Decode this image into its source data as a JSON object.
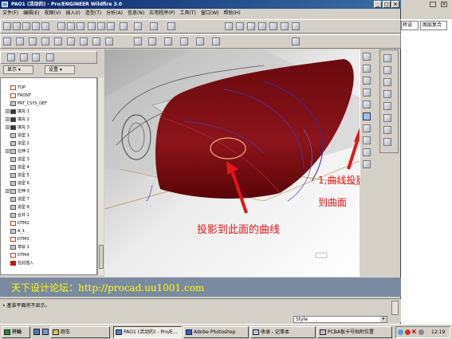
{
  "window": {
    "title": "PAO1 (活动的) - Pro/ENGINEER Wildfire 3.0"
  },
  "menu": [
    "文件(F)",
    "编辑(E)",
    "视图(V)",
    "插入(I)",
    "造型(T)",
    "分析(A)",
    "信息(N)",
    "应用程序(P)",
    "工具(T)",
    "窗口(W)",
    "帮助(H)"
  ],
  "nav_tabs": {
    "show": "显示",
    "settings": "设置"
  },
  "tree": [
    {
      "label": "TOP",
      "icon": "datum-plane-icon",
      "exp": ""
    },
    {
      "label": "FRONT",
      "icon": "datum-plane-icon",
      "exp": ""
    },
    {
      "label": "PRT_CSYS_DEF",
      "icon": "csys-icon",
      "exp": ""
    },
    {
      "label": "填充 1",
      "icon": "fill-icon",
      "exp": "+"
    },
    {
      "label": "填充 2",
      "icon": "fill-icon",
      "exp": "+"
    },
    {
      "label": "填充 3",
      "icon": "fill-icon",
      "exp": "+"
    },
    {
      "label": "造型 1",
      "icon": "style-icon",
      "exp": ""
    },
    {
      "label": "造型 2",
      "icon": "style-icon",
      "exp": ""
    },
    {
      "label": "拉伸 2",
      "icon": "extrude-icon",
      "exp": "+"
    },
    {
      "label": "造型 3",
      "icon": "style-icon",
      "exp": ""
    },
    {
      "label": "造型 4",
      "icon": "style-icon",
      "exp": ""
    },
    {
      "label": "造型 5",
      "icon": "style-icon",
      "exp": ""
    },
    {
      "label": "造型 6",
      "icon": "style-icon",
      "exp": ""
    },
    {
      "label": "拉伸 3",
      "icon": "extrude-icon",
      "exp": "+"
    },
    {
      "label": "造型 7",
      "icon": "style-icon",
      "exp": ""
    },
    {
      "label": "造型 8",
      "icon": "style-icon",
      "exp": ""
    },
    {
      "label": "合并 1",
      "icon": "merge-icon",
      "exp": ""
    },
    {
      "label": "DTM2",
      "icon": "datum-plane-icon",
      "exp": ""
    },
    {
      "label": "A_1",
      "icon": "axis-icon",
      "exp": ""
    },
    {
      "label": "DTM3",
      "icon": "datum-plane-icon",
      "exp": ""
    },
    {
      "label": "草绘 1",
      "icon": "sketch-icon",
      "exp": ""
    },
    {
      "label": "DTM4",
      "icon": "datum-plane-icon",
      "exp": ""
    },
    {
      "label": "在此插入",
      "icon": "insert-arrow-icon",
      "exp": ""
    }
  ],
  "annotations": {
    "surface": "投影到此面的曲线",
    "proj1": "1,曲线投影",
    "proj2": "到曲面"
  },
  "watermark": "天下设计论坛：http://procad.uu1001.com",
  "status": {
    "message": "基准平面将不显示。",
    "filter": "Style"
  },
  "right_panel": {
    "tab1": "转设",
    "tab2": "图层复合"
  },
  "taskbar": {
    "start": "开始",
    "items": [
      "跑车",
      "PAO1 (活动的) - Pro/E...",
      "Adobe Photoshop",
      "收录 - 记事本",
      "PCBA板卡号贴附位置"
    ],
    "clock": "12:19"
  },
  "colors": {
    "surface": "#7a0f14",
    "title_active": "#0a246a",
    "annotation": "#e3151b",
    "watermark": "#ffff00"
  }
}
